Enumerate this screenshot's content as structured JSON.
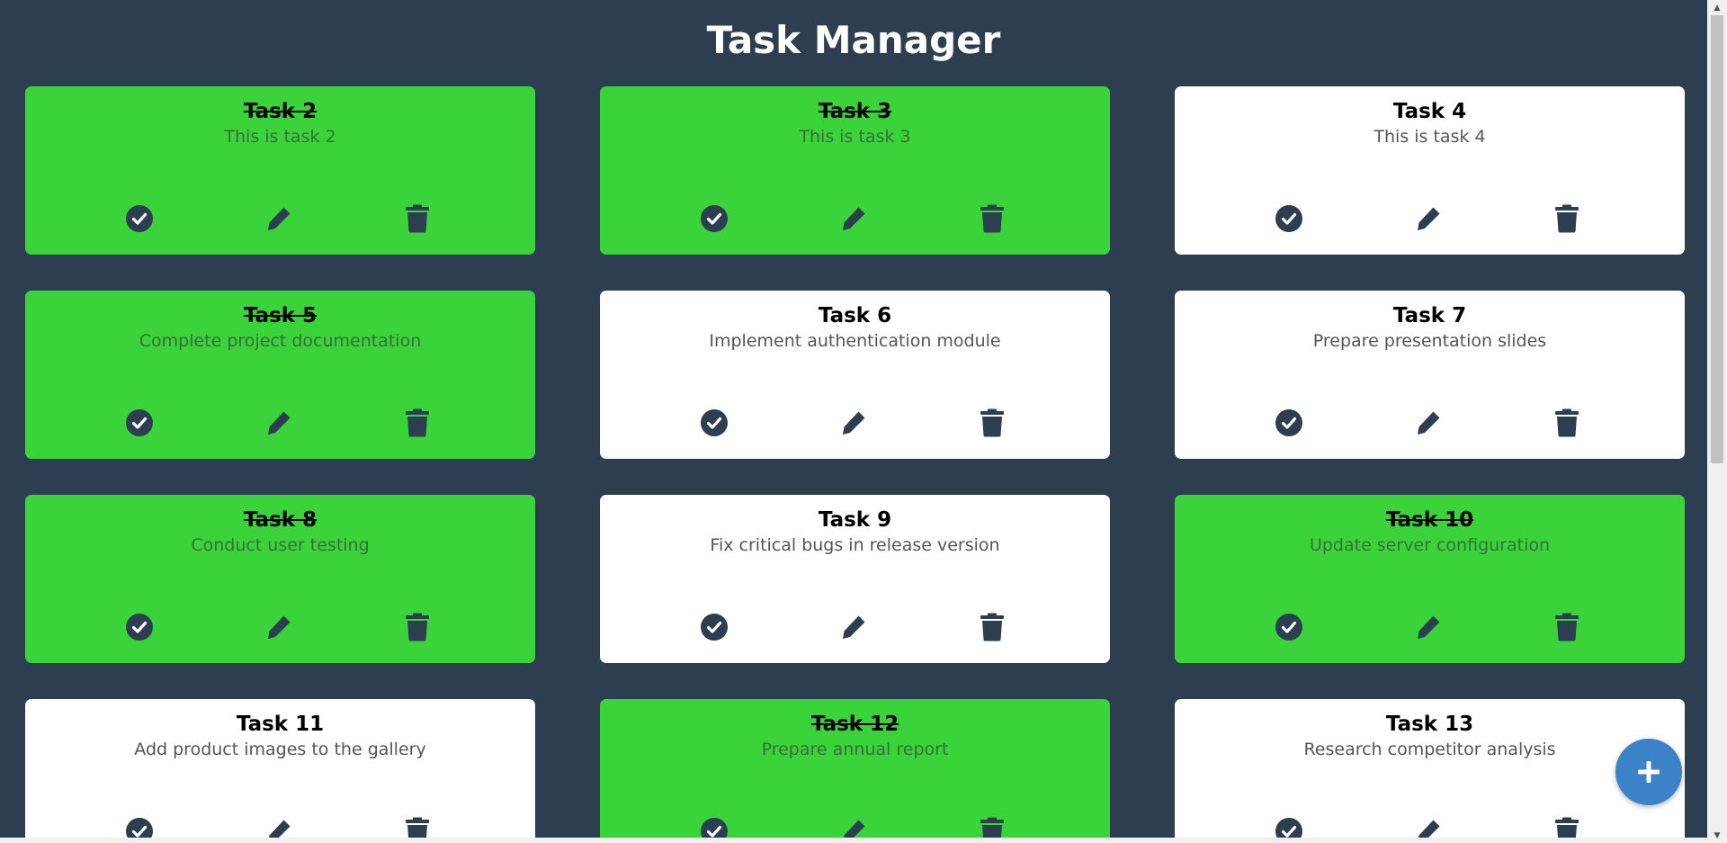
{
  "app": {
    "title": "Task Manager"
  },
  "colors": {
    "background": "#2c3e50",
    "done_card": "#3ad33a",
    "open_card": "#ffffff",
    "icon": "#2c3e50",
    "fab": "#3c82c9"
  },
  "tasks": [
    {
      "title": "Task 2",
      "description": "This is task 2",
      "completed": true
    },
    {
      "title": "Task 3",
      "description": "This is task 3",
      "completed": true
    },
    {
      "title": "Task 4",
      "description": "This is task 4",
      "completed": false
    },
    {
      "title": "Task 5",
      "description": "Complete project documentation",
      "completed": true
    },
    {
      "title": "Task 6",
      "description": "Implement authentication module",
      "completed": false
    },
    {
      "title": "Task 7",
      "description": "Prepare presentation slides",
      "completed": false
    },
    {
      "title": "Task 8",
      "description": "Conduct user testing",
      "completed": true
    },
    {
      "title": "Task 9",
      "description": "Fix critical bugs in release version",
      "completed": false
    },
    {
      "title": "Task 10",
      "description": "Update server configuration",
      "completed": true
    },
    {
      "title": "Task 11",
      "description": "Add product images to the gallery",
      "completed": false
    },
    {
      "title": "Task 12",
      "description": "Prepare annual report",
      "completed": true
    },
    {
      "title": "Task 13",
      "description": "Research competitor analysis",
      "completed": false
    }
  ],
  "icons": {
    "complete": "check-circle-icon",
    "edit": "pencil-icon",
    "delete": "trash-icon",
    "add": "plus-icon"
  }
}
